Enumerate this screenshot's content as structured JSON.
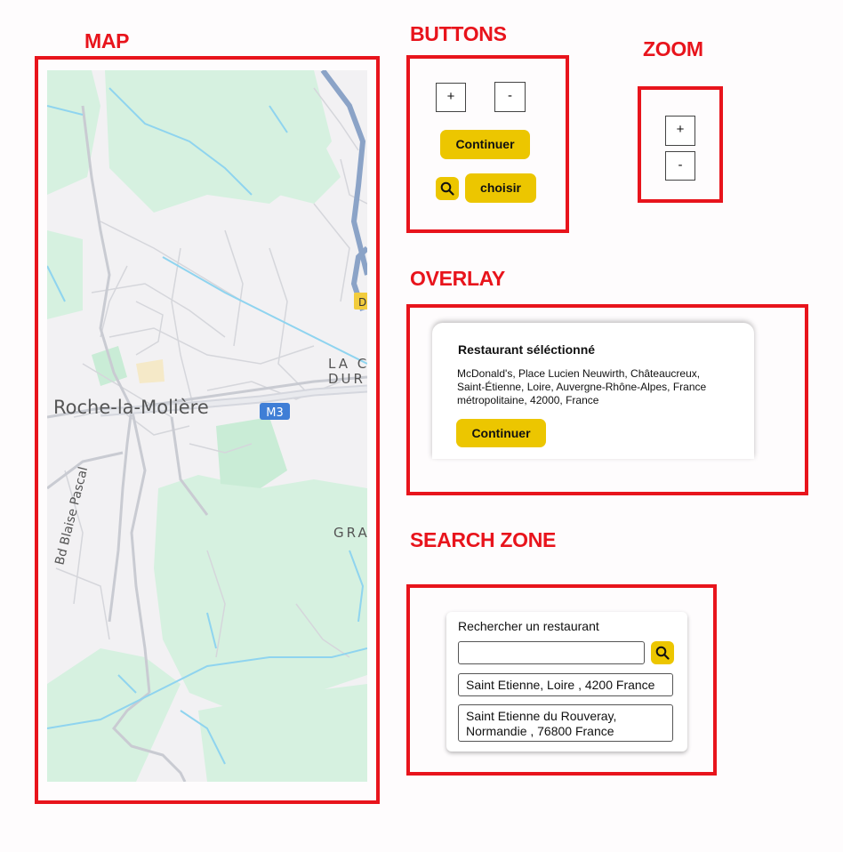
{
  "sections": {
    "map": "MAP",
    "buttons": "BUTTONS",
    "zoom": "ZOOM",
    "overlay": "OVERLAY",
    "search": "SEARCH ZONE"
  },
  "map": {
    "place_main": "Roche-la-Molière",
    "road_badge": "M3",
    "road_name": "Bd Blaise Pascal",
    "label_la": "LA C",
    "label_dur": "DUR",
    "label_gra": "GRA",
    "label_d": "D"
  },
  "buttons": {
    "plus": "+",
    "minus": "-",
    "continue": "Continuer",
    "choose": "choisir",
    "search_icon": "search-icon"
  },
  "zoom": {
    "in": "+",
    "out": "-"
  },
  "overlay": {
    "heading": "Restaurant séléctionné",
    "address": "McDonald's, Place Lucien Neuwirth, Châteaucreux, Saint-Étienne, Loire, Auvergne-Rhône-Alpes, France métropolitaine, 42000, France",
    "continue": "Continuer"
  },
  "search": {
    "label": "Rechercher un restaurant",
    "input_value": "",
    "results": [
      "Saint Etienne, Loire , 4200 France",
      "Saint Etienne du Rouveray, Normandie , 76800 France"
    ]
  },
  "colors": {
    "accent_red": "#e8141c",
    "button_yellow": "#ecc600",
    "map_green": "#d8f0e0",
    "map_water": "#8fd4ef",
    "map_highway": "#8ba3c7"
  }
}
